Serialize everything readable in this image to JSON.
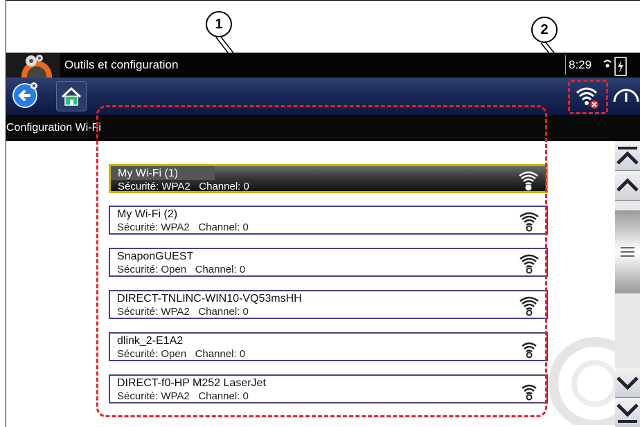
{
  "callouts": {
    "one": "1",
    "two": "2"
  },
  "titlebar": {
    "title": "Outils et configuration",
    "clock": "8:29"
  },
  "subbar": {
    "label": "Configuration Wi-Fi"
  },
  "networks": [
    {
      "name": "My Wi-Fi (1)",
      "security": "Sécurité: WPA2",
      "channel": "Channel: 0"
    },
    {
      "name": "My Wi-Fi (2)",
      "security": "Sécurité: WPA2",
      "channel": "Channel: 0"
    },
    {
      "name": "SnaponGUEST",
      "security": "Sécurité: Open",
      "channel": "Channel: 0"
    },
    {
      "name": "DIRECT-TNLINC-WIN10-VQ53msHH",
      "security": "Sécurité: WPA2",
      "channel": "Channel: 0"
    },
    {
      "name": "dlink_2-E1A2",
      "security": "Sécurité: Open",
      "channel": "Channel: 0"
    },
    {
      "name": "DIRECT-f0-HP M252 LaserJet",
      "security": "Sécurité: WPA2",
      "channel": "Channel: 0"
    }
  ],
  "colors": {
    "highlight": "#e0242c",
    "selected_border": "#c8b400",
    "item_border": "#4a3f86"
  }
}
